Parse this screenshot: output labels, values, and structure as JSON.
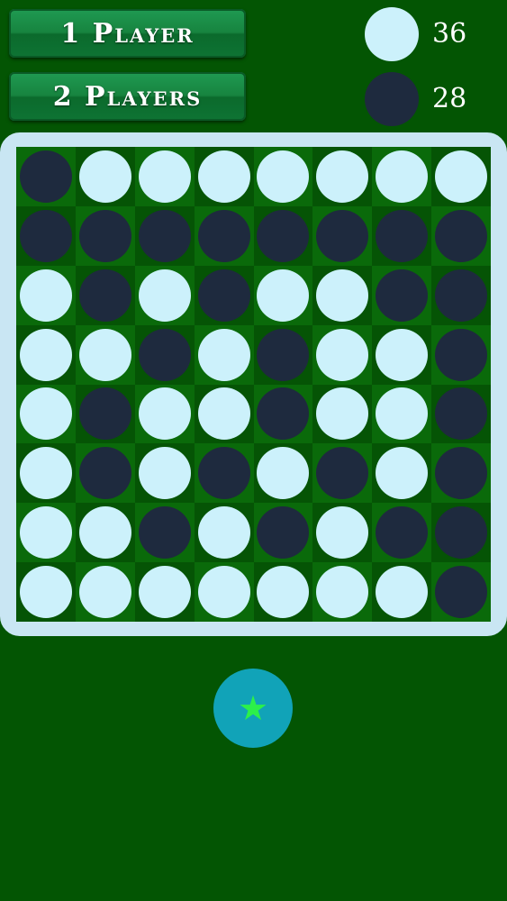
{
  "menu": {
    "one_player": "1 Player",
    "two_players": "2 Players"
  },
  "score": {
    "white": "36",
    "black": "28"
  },
  "colors": {
    "white_disc": "#ccf1fb",
    "black_disc": "#1e2a3e",
    "board_frame": "#c9e6f3",
    "star_button": "#11a3b8",
    "star": "#2cf04a"
  },
  "board": [
    [
      "B",
      "W",
      "W",
      "W",
      "W",
      "W",
      "W",
      "W"
    ],
    [
      "B",
      "B",
      "B",
      "B",
      "B",
      "B",
      "B",
      "B"
    ],
    [
      "W",
      "B",
      "W",
      "B",
      "W",
      "W",
      "B",
      "B"
    ],
    [
      "W",
      "W",
      "B",
      "W",
      "B",
      "W",
      "W",
      "B"
    ],
    [
      "W",
      "B",
      "W",
      "W",
      "B",
      "W",
      "W",
      "B"
    ],
    [
      "W",
      "B",
      "W",
      "B",
      "W",
      "B",
      "W",
      "B"
    ],
    [
      "W",
      "W",
      "B",
      "W",
      "B",
      "W",
      "B",
      "B"
    ],
    [
      "W",
      "W",
      "W",
      "W",
      "W",
      "W",
      "W",
      "B"
    ]
  ],
  "star_icon": "star-icon"
}
